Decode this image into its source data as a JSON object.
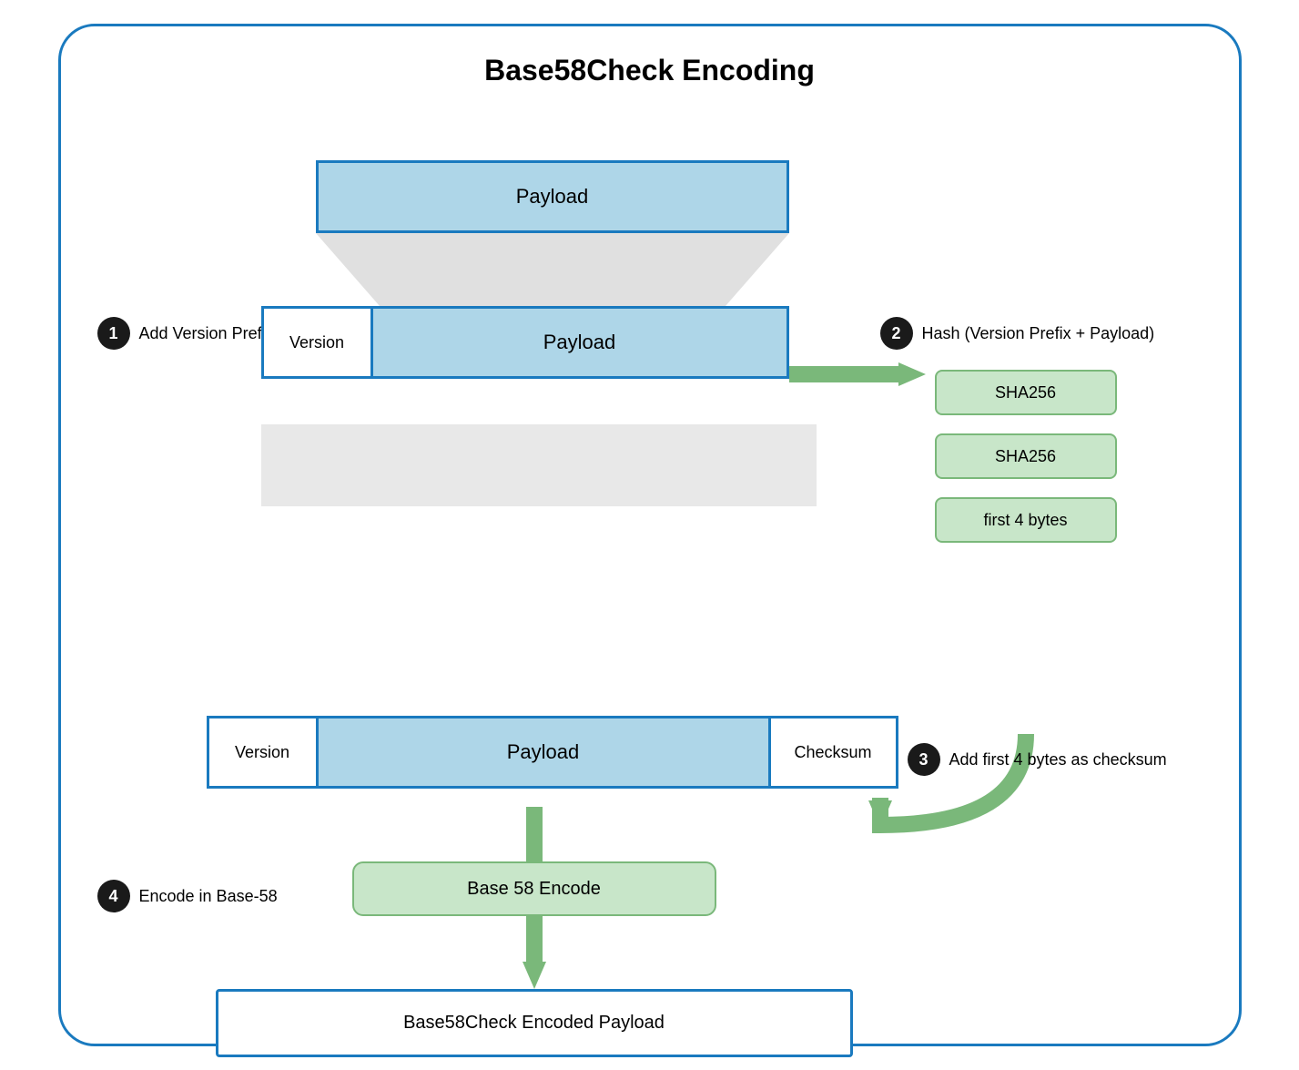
{
  "title": "Base58Check Encoding",
  "steps": [
    {
      "num": "1",
      "label": "Add Version Prefix"
    },
    {
      "num": "2",
      "label": "Hash (Version Prefix + Payload)"
    },
    {
      "num": "3",
      "label": "Add first 4 bytes as checksum"
    },
    {
      "num": "4",
      "label": "Encode in Base-58"
    }
  ],
  "boxes": {
    "payload_top": "Payload",
    "version": "Version",
    "payload_mid": "Payload",
    "payload_mid2": "Payload",
    "version2": "Version",
    "checksum": "Checksum",
    "sha256_1": "SHA256",
    "sha256_2": "SHA256",
    "first4": "first 4 bytes",
    "base58_encode": "Base 58 Encode",
    "final": "Base58Check Encoded Payload"
  }
}
